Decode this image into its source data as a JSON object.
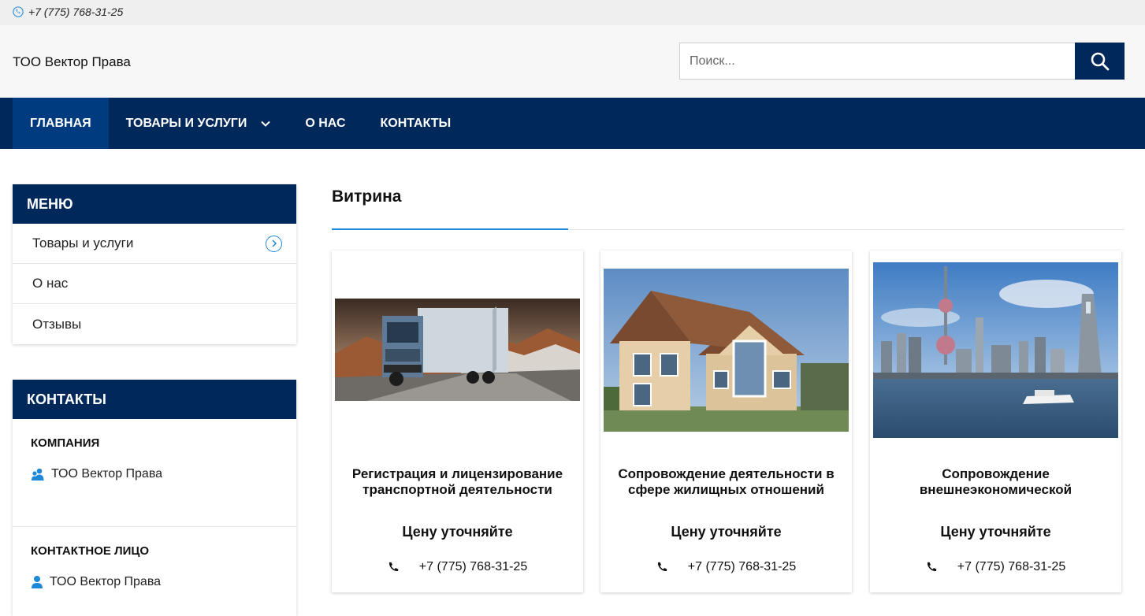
{
  "topbar": {
    "phone": "+7 (775) 768-31-25"
  },
  "header": {
    "brand": "ТОО Вектор Права",
    "search_placeholder": "Поиск..."
  },
  "nav": {
    "items": [
      {
        "label": "ГЛАВНАЯ"
      },
      {
        "label": "ТОВАРЫ И УСЛУГИ"
      },
      {
        "label": "О НАС"
      },
      {
        "label": "КОНТАКТЫ"
      }
    ]
  },
  "sidebar": {
    "menu": {
      "title": "МЕНЮ",
      "items": [
        {
          "label": "Товары и услуги"
        },
        {
          "label": "О нас"
        },
        {
          "label": "Отзывы"
        }
      ]
    },
    "contacts": {
      "title": "КОНТАКТЫ",
      "company_label": "КОМПАНИЯ",
      "company_value": "ТОО Вектор Права",
      "person_label": "КОНТАКТНОЕ ЛИЦО",
      "person_value": "ТОО Вектор Права"
    }
  },
  "main": {
    "title": "Витрина",
    "cards": [
      {
        "title": "Регистрация и лицензирование транспортной деятельности",
        "price": "Цену уточняйте",
        "phone": "+7 (775) 768-31-25"
      },
      {
        "title": "Сопровождение деятельности в сфере жилищных отношений",
        "price": "Цену уточняйте",
        "phone": "+7 (775) 768-31-25"
      },
      {
        "title": "Сопровождение внешнеэкономической деятельности",
        "price": "Цену уточняйте",
        "phone": "+7 (775) 768-31-25"
      }
    ]
  },
  "colors": {
    "primary": "#00285a",
    "active_nav": "#003b7f",
    "accent": "#1e88d8",
    "topbar_bg": "#efefef"
  }
}
